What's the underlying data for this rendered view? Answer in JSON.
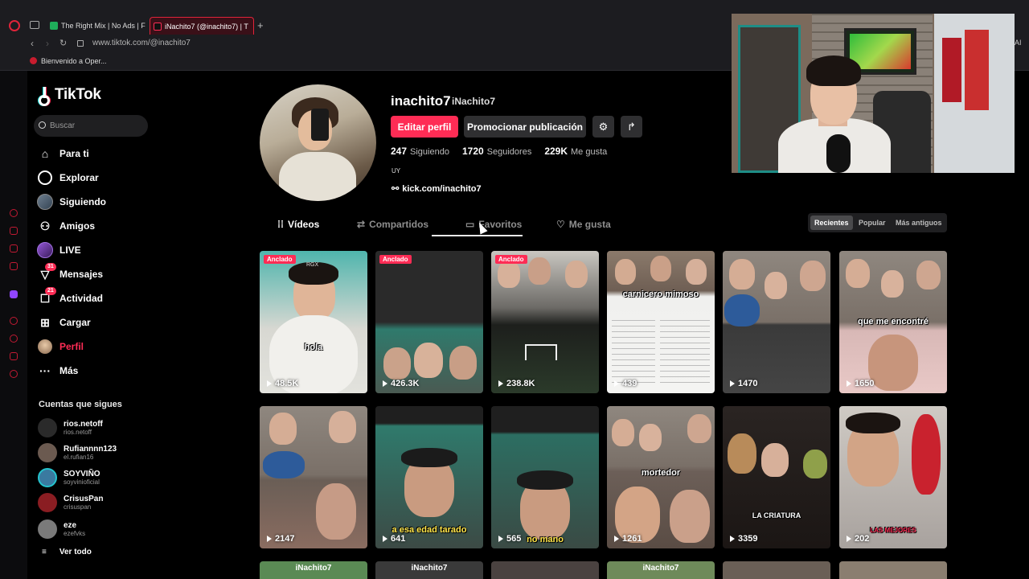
{
  "browser": {
    "tabs": [
      {
        "label": "The Right Mix | No Ads | F",
        "active": false
      },
      {
        "label": "iNachito7 (@inachito7) | T",
        "active": true
      }
    ],
    "new_tab_icon": "plus-icon",
    "url": "www.tiktok.com/@inachito7",
    "bookmark": "Bienvenido a Oper...",
    "ai_label": "AI"
  },
  "sidebar": {
    "logo_text": "TikTok",
    "search_placeholder": "Buscar",
    "nav": [
      {
        "label": "Para ti",
        "icon": "home-icon"
      },
      {
        "label": "Explorar",
        "icon": "compass-icon"
      },
      {
        "label": "Siguiendo",
        "icon": "following-avatar-icon"
      },
      {
        "label": "Amigos",
        "icon": "friends-icon"
      },
      {
        "label": "LIVE",
        "icon": "live-icon"
      },
      {
        "label": "Mensajes",
        "icon": "inbox-icon",
        "badge": "31"
      },
      {
        "label": "Actividad",
        "icon": "activity-icon",
        "badge": "21"
      },
      {
        "label": "Cargar",
        "icon": "upload-icon"
      },
      {
        "label": "Perfil",
        "icon": "profile-icon",
        "active": true
      },
      {
        "label": "Más",
        "icon": "more-icon"
      }
    ],
    "following_title": "Cuentas que sigues",
    "following": [
      {
        "name": "rios.netoff",
        "handle": "rios.netoff",
        "color": "#2a2a2a"
      },
      {
        "name": "Rufiannnn123",
        "handle": "el.rufian16",
        "color": "#6b5a50"
      },
      {
        "name": "SOYVIÑO",
        "handle": "soyvinioficial",
        "color": "#3a7aa0"
      },
      {
        "name": "CrisusPan",
        "handle": "crisuspan",
        "color": "#8a1d22"
      },
      {
        "name": "eze",
        "handle": "ezefvks",
        "color": "#7a7a7a"
      }
    ],
    "see_all": "Ver todo"
  },
  "profile": {
    "username": "inachito7",
    "nickname": "iNachito7",
    "edit_button": "Editar perfil",
    "promote_button": "Promocionar publicación",
    "following_count": "247",
    "following_label": "Siguiendo",
    "followers_count": "1720",
    "followers_label": "Seguidores",
    "likes_count": "229K",
    "likes_label": "Me gusta",
    "bio": "UY",
    "link": "kick.com/inachito7"
  },
  "tabs": [
    "Vídeos",
    "Compartidos",
    "Favoritos",
    "Me gusta"
  ],
  "sort": [
    "Recientes",
    "Popular",
    "Más antiguos"
  ],
  "videos": [
    {
      "views": "48.5K",
      "pinned": "Anclado",
      "caption": "hola",
      "bg": "#57b8b0",
      "overlay": "RGX"
    },
    {
      "views": "426.3K",
      "pinned": "Anclado",
      "caption": "",
      "bg": "#2a2a2a"
    },
    {
      "views": "238.8K",
      "pinned": "Anclado",
      "caption": "",
      "bg": "#3b4a3a"
    },
    {
      "views": "439",
      "caption": "carnicero mimoso",
      "bg": "#e8e8e8"
    },
    {
      "views": "1470",
      "caption": "",
      "bg": "#6a6a6a"
    },
    {
      "views": "1650",
      "caption": "que me encontré",
      "bg": "#7a7068"
    },
    {
      "views": "2147",
      "caption": "",
      "bg": "#6f6a65"
    },
    {
      "views": "641",
      "caption": "a esa edad tarado",
      "bg": "#2f6d5a"
    },
    {
      "views": "565",
      "caption": "no mano",
      "bg": "#2c5e55"
    },
    {
      "views": "1261",
      "caption": "mortedor",
      "bg": "#6a5f56"
    },
    {
      "views": "3359",
      "caption": "LA CRIATURA",
      "bg": "#1f1a18"
    },
    {
      "views": "202",
      "caption": "LAS MEJORES",
      "bg": "#a8a29e"
    }
  ],
  "bottom_row": [
    "iNachito7",
    "iNachito7",
    "",
    "iNachito7",
    "",
    ""
  ]
}
